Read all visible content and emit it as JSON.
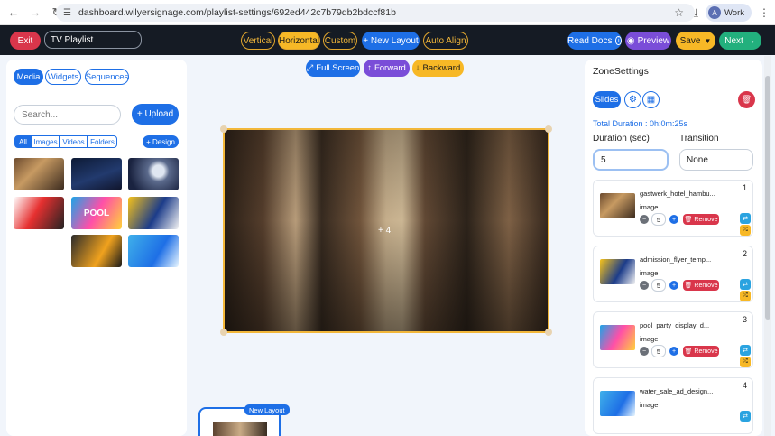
{
  "browser": {
    "url": "dashboard.wilyersignage.com/playlist-settings/692ed442c7b79db2bdccf81b",
    "profile_initial": "A",
    "profile_label": "Work"
  },
  "topbar": {
    "exit_label": "Exit",
    "playlist_name": "TV Playlist",
    "orientation": [
      "Vertical",
      "Horizontal",
      "Custom"
    ],
    "active_orientation": "Horizontal",
    "new_layout_label": "+ New Layout",
    "auto_align_label": "Auto Align",
    "read_docs_label": "Read Docs",
    "preview_label": "Preview",
    "save_label": "Save",
    "next_label": "Next"
  },
  "left_panel": {
    "tabs": [
      "Media",
      "Widgets",
      "Sequences"
    ],
    "active_tab": "Media",
    "search_placeholder": "Search...",
    "upload_label": "+ Upload",
    "filters": [
      "All",
      "Images",
      "Videos",
      "Folders"
    ],
    "active_filter": "All",
    "design_label": "+ Design",
    "media": [
      {
        "thumb": "restaurant"
      },
      {
        "thumb": "night-city"
      },
      {
        "thumb": "moon"
      },
      {
        "thumb": "sale"
      },
      {
        "thumb": "pool",
        "text": "POOL"
      },
      {
        "thumb": "school"
      },
      {
        "thumb": "offroad"
      },
      {
        "thumb": "water"
      }
    ]
  },
  "canvas": {
    "full_screen_label": "Full Screen",
    "forward_label": "Forward",
    "backward_label": "Backward",
    "zone_label": "+ 4",
    "new_layout_badge": "New Layout"
  },
  "zone_settings": {
    "title": "ZoneSettings",
    "slides_label": "Slides",
    "total_duration": "Total Duration : 0h:0m:25s",
    "duration_label": "Duration (sec)",
    "duration_value": "5",
    "transition_label": "Transition",
    "transition_value": "None",
    "slides": [
      {
        "num": "1",
        "name": "gastwerk_hotel_hambu...",
        "type": "image",
        "duration": "5",
        "remove_label": "Remove",
        "thumb": "restaurant"
      },
      {
        "num": "2",
        "name": "admission_flyer_temp...",
        "type": "image",
        "duration": "5",
        "remove_label": "Remove",
        "thumb": "school"
      },
      {
        "num": "3",
        "name": "pool_party_display_d...",
        "type": "image",
        "duration": "5",
        "remove_label": "Remove",
        "thumb": "pool"
      },
      {
        "num": "4",
        "name": "water_sale_ad_design...",
        "type": "image",
        "duration": "",
        "remove_label": "",
        "thumb": "water"
      }
    ]
  }
}
